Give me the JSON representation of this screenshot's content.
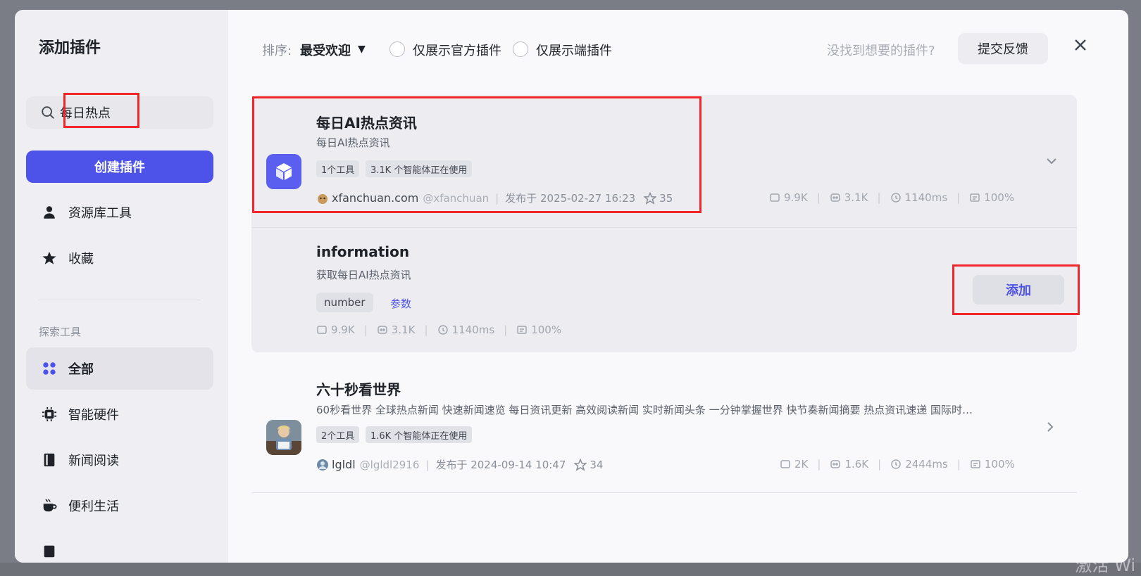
{
  "modal": {
    "title": "添加插件"
  },
  "sidebar": {
    "search": {
      "value": "每日热点",
      "placeholder": ""
    },
    "create_button": "创建插件",
    "items": [
      {
        "label": "资源库工具",
        "icon": "user-icon"
      },
      {
        "label": "收藏",
        "icon": "star-icon"
      }
    ],
    "section_title": "探索工具",
    "categories": [
      {
        "label": "全部",
        "icon": "grid-icon",
        "active": true
      },
      {
        "label": "智能硬件",
        "icon": "chip-icon"
      },
      {
        "label": "新闻阅读",
        "icon": "book-icon"
      },
      {
        "label": "便利生活",
        "icon": "cup-icon"
      }
    ]
  },
  "toolbar": {
    "sort_label": "排序:",
    "sort_value": "最受欢迎",
    "filter_official": "仅展示官方插件",
    "filter_endside": "仅展示端插件",
    "feedback_hint": "没找到想要的插件?",
    "feedback_button": "提交反馈"
  },
  "plugins": [
    {
      "title": "每日AI热点资讯",
      "desc": "每日AI热点资讯",
      "tags": [
        "1个工具",
        "3.1K 个智能体正在使用"
      ],
      "author": "xfanchuan.com",
      "handle": "@xfanchuan",
      "published": "发布于 2025-02-27 16:23",
      "stars": "35",
      "stats": {
        "calls": "9.9K",
        "bots": "3.1K",
        "latency": "1140ms",
        "success": "100%"
      },
      "tool": {
        "name": "information",
        "desc": "获取每日AI热点资讯",
        "param_tag": "number",
        "param_link": "参数",
        "add_button": "添加",
        "stats": {
          "calls": "9.9K",
          "bots": "3.1K",
          "latency": "1140ms",
          "success": "100%"
        }
      }
    },
    {
      "title": "六十秒看世界",
      "desc": "60秒看世界 全球热点新闻 快速新闻速览 每日资讯更新 高效阅读新闻 实时新闻头条 一分钟掌握世界 快节奏新闻摘要 热点资讯速递 国际时…",
      "tags": [
        "2个工具",
        "1.6K 个智能体正在使用"
      ],
      "author": "lgldl",
      "handle": "@lgldl2916",
      "published": "发布于 2024-09-14 10:47",
      "stars": "34",
      "stats": {
        "calls": "2K",
        "bots": "1.6K",
        "latency": "2444ms",
        "success": "100%"
      }
    }
  ],
  "colors": {
    "accent": "#4d53e8",
    "highlight": "#f2262a"
  }
}
